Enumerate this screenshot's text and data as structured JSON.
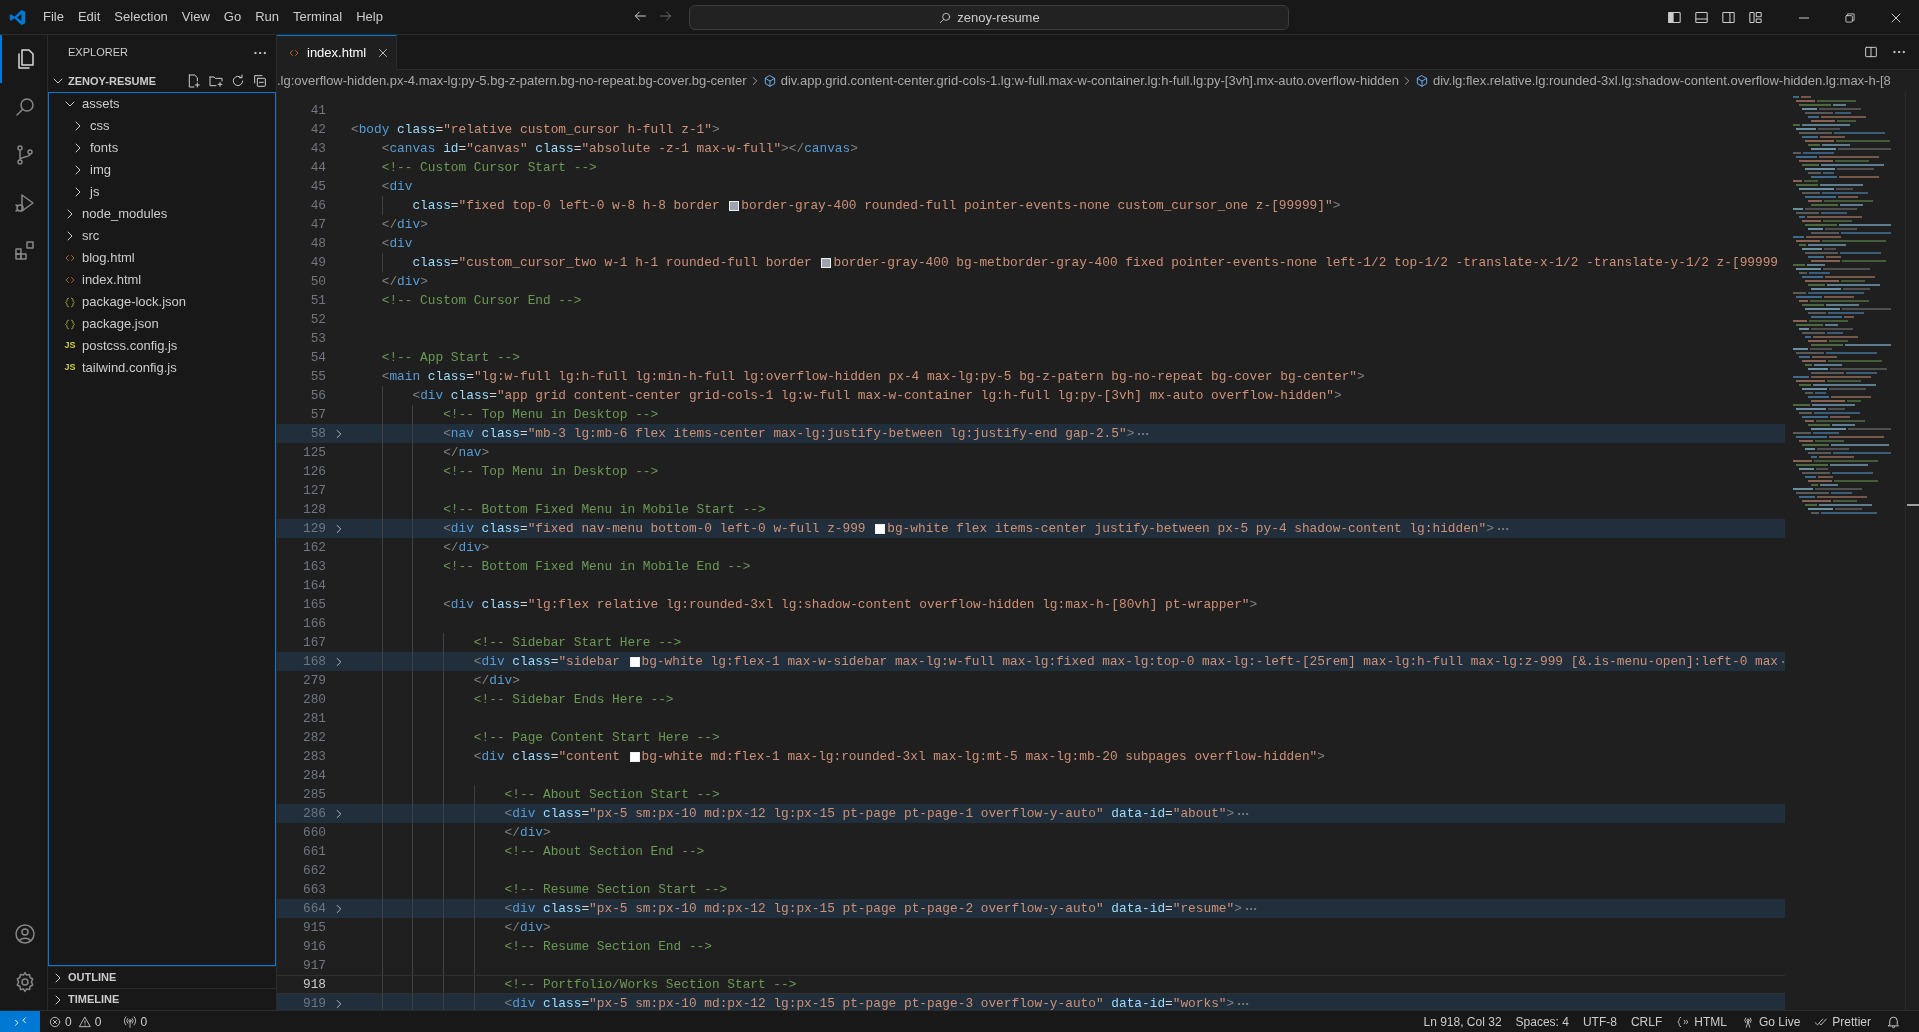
{
  "title_bar": {
    "menu": [
      "File",
      "Edit",
      "Selection",
      "View",
      "Go",
      "Run",
      "Terminal",
      "Help"
    ],
    "command_center": "zenoy-resume"
  },
  "activity_bar": {
    "top": [
      {
        "kind": "explorer",
        "selected": true
      },
      {
        "kind": "search",
        "selected": false
      },
      {
        "kind": "source-control",
        "selected": false
      },
      {
        "kind": "run-debug",
        "selected": false
      },
      {
        "kind": "extensions",
        "selected": false
      }
    ],
    "bottom": [
      {
        "kind": "account",
        "selected": false
      },
      {
        "kind": "settings",
        "selected": false
      }
    ]
  },
  "sidebar": {
    "title": "EXPLORER",
    "section": {
      "title": "ZENOY-RESUME",
      "expanded": true,
      "items": [
        {
          "kind": "folder",
          "label": "assets",
          "expanded": true,
          "children": [
            {
              "kind": "folder",
              "label": "css",
              "expanded": false
            },
            {
              "kind": "folder",
              "label": "fonts",
              "expanded": false
            },
            {
              "kind": "folder",
              "label": "img",
              "expanded": false
            },
            {
              "kind": "folder",
              "label": "js",
              "expanded": false
            }
          ]
        },
        {
          "kind": "folder",
          "label": "node_modules",
          "expanded": false
        },
        {
          "kind": "folder",
          "label": "src",
          "expanded": false
        },
        {
          "kind": "html-file",
          "label": "blog.html"
        },
        {
          "kind": "html-file",
          "label": "index.html"
        },
        {
          "kind": "json-file",
          "label": "package-lock.json"
        },
        {
          "kind": "json-file",
          "label": "package.json"
        },
        {
          "kind": "js-file",
          "label": "postcss.config.js",
          "badge": "JS"
        },
        {
          "kind": "js-file",
          "label": "tailwind.config.js",
          "badge": "JS"
        }
      ]
    },
    "panels": [
      {
        "title": "OUTLINE",
        "expanded": false
      },
      {
        "title": "TIMELINE",
        "expanded": false
      }
    ]
  },
  "editor": {
    "tabs": [
      {
        "label": "index.html",
        "selected": true
      }
    ],
    "breadcrumb": [
      {
        "kind": "plain",
        "text": ".lg:overflow-hidden.px-4.max-lg:py-5.bg-z-patern.bg-no-repeat.bg-cover.bg-center"
      },
      {
        "kind": "element",
        "text": "div.app.grid.content-center.grid-cols-1.lg:w-full.max-w-container.lg:h-full.lg:py-[3vh].mx-auto.overflow-hidden"
      },
      {
        "kind": "element",
        "text": "div.lg:flex.relative.lg:rounded-3xl.lg:shadow-content.overflow-hidden.lg:max-h-[8"
      }
    ],
    "lines": [
      {
        "number": "41",
        "folded": false,
        "current": false
      },
      {
        "number": "42",
        "folded": false,
        "current": false,
        "tokens": [
          {
            "kind": "punct",
            "text": "<"
          },
          {
            "kind": "tag",
            "text": "body"
          },
          {
            "kind": "attr",
            "text": " class"
          },
          {
            "kind": "eq",
            "text": "="
          },
          {
            "kind": "string",
            "text": "\"relative custom_cursor h-full z-1\""
          },
          {
            "kind": "punct",
            "text": ">"
          }
        ]
      },
      {
        "number": "43",
        "folded": false,
        "current": false,
        "tokens": [
          {
            "kind": "punct",
            "text": "    <"
          },
          {
            "kind": "tag",
            "text": "canvas"
          },
          {
            "kind": "attr",
            "text": " id"
          },
          {
            "kind": "eq",
            "text": "="
          },
          {
            "kind": "string",
            "text": "\"canvas\""
          },
          {
            "kind": "attr",
            "text": " class"
          },
          {
            "kind": "eq",
            "text": "="
          },
          {
            "kind": "string",
            "text": "\"absolute -z-1 max-w-full\""
          },
          {
            "kind": "punct",
            "text": "></"
          },
          {
            "kind": "tag",
            "text": "canvas"
          },
          {
            "kind": "punct",
            "text": ">"
          }
        ]
      },
      {
        "number": "44",
        "folded": false,
        "current": false,
        "tokens": [
          {
            "kind": "comment",
            "text": "    <!-- Custom Cursor Start -->"
          }
        ]
      },
      {
        "number": "45",
        "folded": false,
        "current": false,
        "tokens": [
          {
            "kind": "punct",
            "text": "    <"
          },
          {
            "kind": "tag",
            "text": "div"
          }
        ]
      },
      {
        "number": "46",
        "folded": false,
        "current": false,
        "tokens": [
          {
            "kind": "attr",
            "text": "        class"
          },
          {
            "kind": "eq",
            "text": "="
          },
          {
            "kind": "string",
            "text": "\"fixed top-0 left-0 w-8 h-8 border "
          },
          {
            "kind": "swatch",
            "color": "#9ca3af"
          },
          {
            "kind": "string",
            "text": "border-gray-400 rounded-full pointer-events-none custom_cursor_one z-[99999]\""
          },
          {
            "kind": "punct",
            "text": ">"
          }
        ]
      },
      {
        "number": "47",
        "folded": false,
        "current": false,
        "tokens": [
          {
            "kind": "punct",
            "text": "    </"
          },
          {
            "kind": "tag",
            "text": "div"
          },
          {
            "kind": "punct",
            "text": ">"
          }
        ]
      },
      {
        "number": "48",
        "folded": false,
        "current": false,
        "tokens": [
          {
            "kind": "punct",
            "text": "    <"
          },
          {
            "kind": "tag",
            "text": "div"
          }
        ]
      },
      {
        "number": "49",
        "folded": false,
        "current": false,
        "tokens": [
          {
            "kind": "attr",
            "text": "        class"
          },
          {
            "kind": "eq",
            "text": "="
          },
          {
            "kind": "string",
            "text": "\"custom_cursor_two w-1 h-1 rounded-full border "
          },
          {
            "kind": "swatch",
            "color": "#9ca3af"
          },
          {
            "kind": "string",
            "text": "border-gray-400 bg-metborder-gray-400 fixed pointer-events-none left-1/2 top-1/2 -translate-x-1/2 -translate-y-1/2 z-[99999"
          }
        ]
      },
      {
        "number": "50",
        "folded": false,
        "current": false,
        "tokens": [
          {
            "kind": "punct",
            "text": "    </"
          },
          {
            "kind": "tag",
            "text": "div"
          },
          {
            "kind": "punct",
            "text": ">"
          }
        ]
      },
      {
        "number": "51",
        "folded": false,
        "current": false,
        "tokens": [
          {
            "kind": "comment",
            "text": "    <!-- Custom Cursor End -->"
          }
        ]
      },
      {
        "number": "52",
        "folded": false,
        "current": false
      },
      {
        "number": "53",
        "folded": false,
        "current": false
      },
      {
        "number": "54",
        "folded": false,
        "current": false,
        "tokens": [
          {
            "kind": "comment",
            "text": "    <!-- App Start -->"
          }
        ]
      },
      {
        "number": "55",
        "folded": false,
        "current": false,
        "tokens": [
          {
            "kind": "punct",
            "text": "    <"
          },
          {
            "kind": "tag",
            "text": "main"
          },
          {
            "kind": "attr",
            "text": " class"
          },
          {
            "kind": "eq",
            "text": "="
          },
          {
            "kind": "string",
            "text": "\"lg:w-full lg:h-full lg:min-h-full lg:overflow-hidden px-4 max-lg:py-5 bg-z-patern bg-no-repeat bg-cover bg-center\""
          },
          {
            "kind": "punct",
            "text": ">"
          }
        ]
      },
      {
        "number": "56",
        "folded": false,
        "current": false,
        "tokens": [
          {
            "kind": "punct",
            "text": "        <"
          },
          {
            "kind": "tag",
            "text": "div"
          },
          {
            "kind": "attr",
            "text": " class"
          },
          {
            "kind": "eq",
            "text": "="
          },
          {
            "kind": "string",
            "text": "\"app grid content-center grid-cols-1 lg:w-full max-w-container lg:h-full lg:py-[3vh] mx-auto overflow-hidden\""
          },
          {
            "kind": "punct",
            "text": ">"
          }
        ]
      },
      {
        "number": "57",
        "folded": false,
        "current": false,
        "tokens": [
          {
            "kind": "comment",
            "text": "            <!-- Top Menu in Desktop -->"
          }
        ]
      },
      {
        "number": "58",
        "folded": true,
        "current": false,
        "tokens": [
          {
            "kind": "punct",
            "text": "            <"
          },
          {
            "kind": "tag",
            "text": "nav"
          },
          {
            "kind": "attr",
            "text": " class"
          },
          {
            "kind": "eq",
            "text": "="
          },
          {
            "kind": "string",
            "text": "\"mb-3 lg:mb-6 flex items-center max-lg:justify-between lg:justify-end gap-2.5\""
          },
          {
            "kind": "punct",
            "text": ">"
          }
        ]
      },
      {
        "number": "125",
        "folded": false,
        "current": false,
        "tokens": [
          {
            "kind": "punct",
            "text": "            </"
          },
          {
            "kind": "tag",
            "text": "nav"
          },
          {
            "kind": "punct",
            "text": ">"
          }
        ]
      },
      {
        "number": "126",
        "folded": false,
        "current": false,
        "tokens": [
          {
            "kind": "comment",
            "text": "            <!-- Top Menu in Desktop -->"
          }
        ]
      },
      {
        "number": "127",
        "folded": false,
        "current": false
      },
      {
        "number": "128",
        "folded": false,
        "current": false,
        "tokens": [
          {
            "kind": "comment",
            "text": "            <!-- Bottom Fixed Menu in Mobile Start -->"
          }
        ]
      },
      {
        "number": "129",
        "folded": true,
        "current": false,
        "tokens": [
          {
            "kind": "punct",
            "text": "            <"
          },
          {
            "kind": "tag",
            "text": "div"
          },
          {
            "kind": "attr",
            "text": " class"
          },
          {
            "kind": "eq",
            "text": "="
          },
          {
            "kind": "string",
            "text": "\"fixed nav-menu bottom-0 left-0 w-full z-999 "
          },
          {
            "kind": "swatch",
            "color": "#ffffff"
          },
          {
            "kind": "string",
            "text": "bg-white flex items-center justify-between px-5 py-4 shadow-content lg:hidden\""
          },
          {
            "kind": "punct",
            "text": ">"
          }
        ]
      },
      {
        "number": "162",
        "folded": false,
        "current": false,
        "tokens": [
          {
            "kind": "punct",
            "text": "            </"
          },
          {
            "kind": "tag",
            "text": "div"
          },
          {
            "kind": "punct",
            "text": ">"
          }
        ]
      },
      {
        "number": "163",
        "folded": false,
        "current": false,
        "tokens": [
          {
            "kind": "comment",
            "text": "            <!-- Bottom Fixed Menu in Mobile End -->"
          }
        ]
      },
      {
        "number": "164",
        "folded": false,
        "current": false
      },
      {
        "number": "165",
        "folded": false,
        "current": false,
        "tokens": [
          {
            "kind": "punct",
            "text": "            <"
          },
          {
            "kind": "tag",
            "text": "div"
          },
          {
            "kind": "attr",
            "text": " class"
          },
          {
            "kind": "eq",
            "text": "="
          },
          {
            "kind": "string",
            "text": "\"lg:flex relative lg:rounded-3xl lg:shadow-content overflow-hidden lg:max-h-[80vh] pt-wrapper\""
          },
          {
            "kind": "punct",
            "text": ">"
          }
        ]
      },
      {
        "number": "166",
        "folded": false,
        "current": false
      },
      {
        "number": "167",
        "folded": false,
        "current": false,
        "tokens": [
          {
            "kind": "comment",
            "text": "                <!-- Sidebar Start Here -->"
          }
        ]
      },
      {
        "number": "168",
        "folded": true,
        "current": false,
        "tokens": [
          {
            "kind": "punct",
            "text": "                <"
          },
          {
            "kind": "tag",
            "text": "div"
          },
          {
            "kind": "attr",
            "text": " class"
          },
          {
            "kind": "eq",
            "text": "="
          },
          {
            "kind": "string",
            "text": "\"sidebar "
          },
          {
            "kind": "swatch",
            "color": "#ffffff"
          },
          {
            "kind": "string",
            "text": "bg-white lg:flex-1 max-w-sidebar max-lg:w-full max-lg:fixed max-lg:top-0 max-lg:-left-[25rem] max-lg:h-full max-lg:z-999 [&.is-menu-open]:left-0 max"
          }
        ]
      },
      {
        "number": "279",
        "folded": false,
        "current": false,
        "tokens": [
          {
            "kind": "punct",
            "text": "                </"
          },
          {
            "kind": "tag",
            "text": "div"
          },
          {
            "kind": "punct",
            "text": ">"
          }
        ]
      },
      {
        "number": "280",
        "folded": false,
        "current": false,
        "tokens": [
          {
            "kind": "comment",
            "text": "                <!-- Sidebar Ends Here -->"
          }
        ]
      },
      {
        "number": "281",
        "folded": false,
        "current": false
      },
      {
        "number": "282",
        "folded": false,
        "current": false,
        "tokens": [
          {
            "kind": "comment",
            "text": "                <!-- Page Content Start Here -->"
          }
        ]
      },
      {
        "number": "283",
        "folded": false,
        "current": false,
        "tokens": [
          {
            "kind": "punct",
            "text": "                <"
          },
          {
            "kind": "tag",
            "text": "div"
          },
          {
            "kind": "attr",
            "text": " class"
          },
          {
            "kind": "eq",
            "text": "="
          },
          {
            "kind": "string",
            "text": "\"content "
          },
          {
            "kind": "swatch",
            "color": "#ffffff"
          },
          {
            "kind": "string",
            "text": "bg-white md:flex-1 max-lg:rounded-3xl max-lg:mt-5 max-lg:mb-20 subpages overflow-hidden\""
          },
          {
            "kind": "punct",
            "text": ">"
          }
        ]
      },
      {
        "number": "284",
        "folded": false,
        "current": false
      },
      {
        "number": "285",
        "folded": false,
        "current": false,
        "tokens": [
          {
            "kind": "comment",
            "text": "                    <!-- About Section Start -->"
          }
        ]
      },
      {
        "number": "286",
        "folded": true,
        "current": false,
        "tokens": [
          {
            "kind": "punct",
            "text": "                    <"
          },
          {
            "kind": "tag",
            "text": "div"
          },
          {
            "kind": "attr",
            "text": " class"
          },
          {
            "kind": "eq",
            "text": "="
          },
          {
            "kind": "string",
            "text": "\"px-5 sm:px-10 md:px-12 lg:px-15 pt-page pt-page-1 overflow-y-auto\""
          },
          {
            "kind": "attr",
            "text": " data-id"
          },
          {
            "kind": "eq",
            "text": "="
          },
          {
            "kind": "string",
            "text": "\"about\""
          },
          {
            "kind": "punct",
            "text": ">"
          }
        ]
      },
      {
        "number": "660",
        "folded": false,
        "current": false,
        "tokens": [
          {
            "kind": "punct",
            "text": "                    </"
          },
          {
            "kind": "tag",
            "text": "div"
          },
          {
            "kind": "punct",
            "text": ">"
          }
        ]
      },
      {
        "number": "661",
        "folded": false,
        "current": false,
        "tokens": [
          {
            "kind": "comment",
            "text": "                    <!-- About Section End -->"
          }
        ]
      },
      {
        "number": "662",
        "folded": false,
        "current": false
      },
      {
        "number": "663",
        "folded": false,
        "current": false,
        "tokens": [
          {
            "kind": "comment",
            "text": "                    <!-- Resume Section Start -->"
          }
        ]
      },
      {
        "number": "664",
        "folded": true,
        "current": false,
        "tokens": [
          {
            "kind": "punct",
            "text": "                    <"
          },
          {
            "kind": "tag",
            "text": "div"
          },
          {
            "kind": "attr",
            "text": " class"
          },
          {
            "kind": "eq",
            "text": "="
          },
          {
            "kind": "string",
            "text": "\"px-5 sm:px-10 md:px-12 lg:px-15 pt-page pt-page-2 overflow-y-auto\""
          },
          {
            "kind": "attr",
            "text": " data-id"
          },
          {
            "kind": "eq",
            "text": "="
          },
          {
            "kind": "string",
            "text": "\"resume\""
          },
          {
            "kind": "punct",
            "text": ">"
          }
        ]
      },
      {
        "number": "915",
        "folded": false,
        "current": false,
        "tokens": [
          {
            "kind": "punct",
            "text": "                    </"
          },
          {
            "kind": "tag",
            "text": "div"
          },
          {
            "kind": "punct",
            "text": ">"
          }
        ]
      },
      {
        "number": "916",
        "folded": false,
        "current": false,
        "tokens": [
          {
            "kind": "comment",
            "text": "                    <!-- Resume Section End -->"
          }
        ]
      },
      {
        "number": "917",
        "folded": false,
        "current": false
      },
      {
        "number": "918",
        "folded": false,
        "current": true,
        "tokens": [
          {
            "kind": "comment",
            "text": "                    <!-- Portfolio/Works Section Start -->"
          }
        ]
      },
      {
        "number": "919",
        "folded": true,
        "current": false,
        "tokens": [
          {
            "kind": "punct",
            "text": "                    <"
          },
          {
            "kind": "tag",
            "text": "div"
          },
          {
            "kind": "attr",
            "text": " class"
          },
          {
            "kind": "eq",
            "text": "="
          },
          {
            "kind": "string",
            "text": "\"px-5 sm:px-10 md:px-12 lg:px-15 pt-page pt-page-3 overflow-y-auto\""
          },
          {
            "kind": "attr",
            "text": " data-id"
          },
          {
            "kind": "eq",
            "text": "="
          },
          {
            "kind": "string",
            "text": "\"works\""
          },
          {
            "kind": "punct",
            "text": ">"
          }
        ]
      }
    ]
  },
  "status_bar": {
    "left": [
      {
        "kind": "remote"
      },
      {
        "kind": "problems",
        "errors": "0",
        "warnings": "0"
      },
      {
        "kind": "ports",
        "text": "0"
      }
    ],
    "right": [
      {
        "kind": "cursor",
        "text": "Ln 918, Col 32"
      },
      {
        "kind": "plain",
        "text": "Spaces: 4"
      },
      {
        "kind": "plain",
        "text": "UTF-8"
      },
      {
        "kind": "plain",
        "text": "CRLF"
      },
      {
        "kind": "language",
        "text": "HTML"
      },
      {
        "kind": "live",
        "text": "Go Live"
      },
      {
        "kind": "prettier",
        "text": "Prettier"
      },
      {
        "kind": "bell"
      }
    ]
  }
}
